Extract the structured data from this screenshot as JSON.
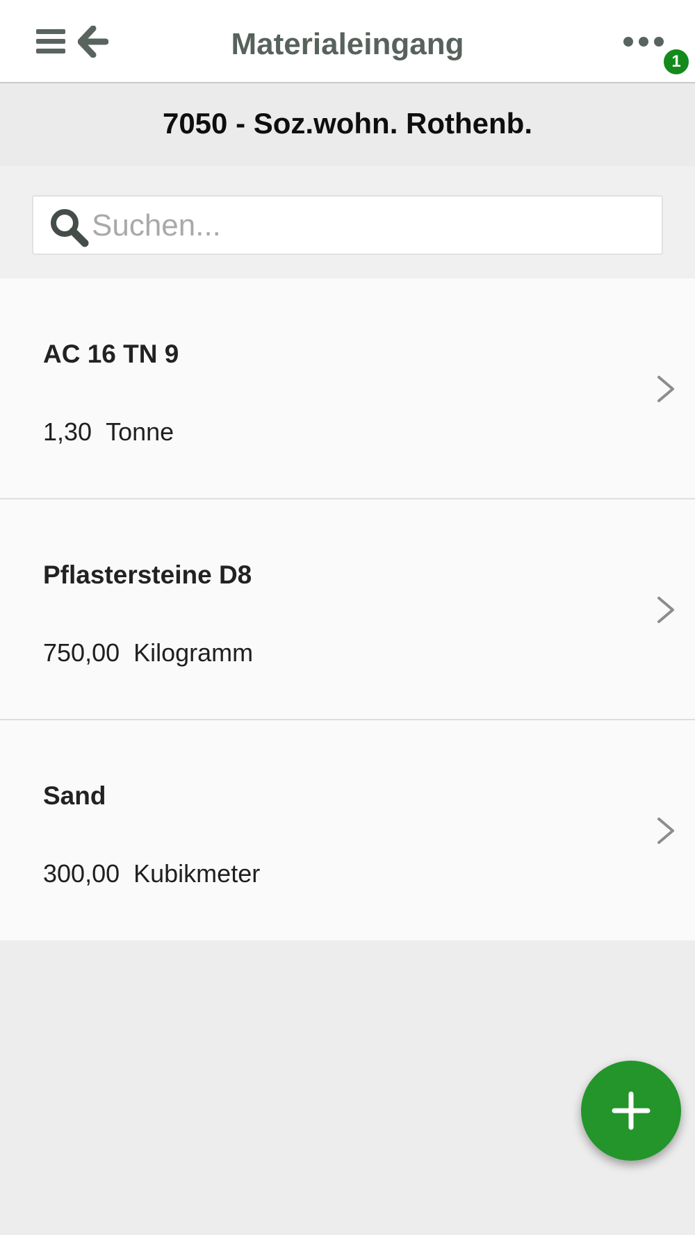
{
  "header": {
    "title": "Materialeingang",
    "menu_icon": "hamburger-menu-icon",
    "back_icon": "arrow-left-icon",
    "more_icon": "more-dots-icon",
    "notification_count": "1"
  },
  "project": {
    "title": "7050 - Soz.wohn. Rothenb."
  },
  "search": {
    "placeholder": "Suchen...",
    "value": "",
    "icon": "search-icon"
  },
  "materials": [
    {
      "name": "AC 16 TN 9",
      "quantity": "1,30",
      "unit": "Tonne"
    },
    {
      "name": "Pflastersteine D8",
      "quantity": "750,00",
      "unit": "Kilogramm"
    },
    {
      "name": "Sand",
      "quantity": "300,00",
      "unit": "Kubikmeter"
    }
  ],
  "fab": {
    "icon": "plus-icon"
  },
  "colors": {
    "accent": "#23952a",
    "badge": "#148a1c",
    "title": "#58625c",
    "icon": "#5a645e"
  }
}
